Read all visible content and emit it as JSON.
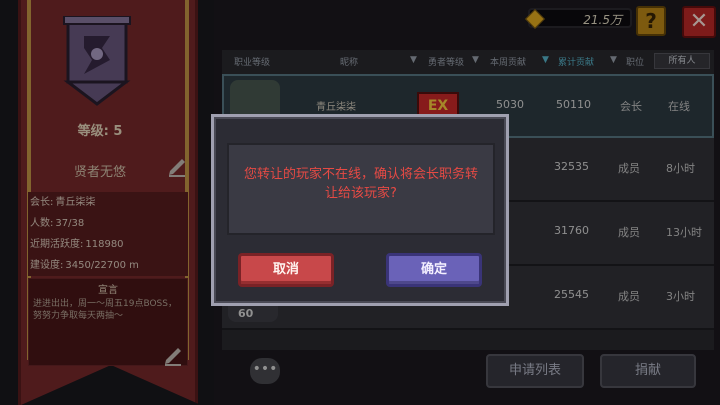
{
  "topbar": {
    "currency": "21.5万",
    "help_label": "?",
    "close_label": "✕"
  },
  "guild": {
    "level": "等级: 5",
    "name": "贤者无悠",
    "info": [
      {
        "label": "会长:",
        "value": "青丘柒柒"
      },
      {
        "label": "人数:",
        "value": "37/38"
      },
      {
        "label": "近期活跃度:",
        "value": "118980"
      },
      {
        "label": "建设度:",
        "value": "3450/22700 m"
      }
    ],
    "announcement_title": "宣言",
    "announcement_text": "进进出出，周一～周五19点BOSS，努努力争取每天两抽～"
  },
  "table": {
    "headers": {
      "job_level": "职业等级",
      "nickname": "昵称",
      "hero_level": "勇者等级",
      "weekly": "本周贡献",
      "total": "累计贡献",
      "role": "职位",
      "filter": "所有人"
    },
    "rows": [
      {
        "name": "青丘柒柒",
        "weekly": "5030",
        "total": "50110",
        "role": "会长",
        "status": "在线",
        "level": ""
      },
      {
        "name": "",
        "weekly": "50",
        "total": "32535",
        "role": "成员",
        "status": "8小时",
        "level": ""
      },
      {
        "name": "",
        "weekly": "00",
        "total": "31760",
        "role": "成员",
        "status": "13小时",
        "level": ""
      },
      {
        "name": "",
        "weekly": "70",
        "total": "25545",
        "role": "成员",
        "status": "3小时",
        "level": "60"
      }
    ]
  },
  "footer": {
    "apply_label": "申请列表",
    "donate_label": "捐献"
  },
  "dialog": {
    "message": "您转让的玩家不在线，确认将会长职务转让给该玩家?",
    "cancel_label": "取消",
    "confirm_label": "确定"
  },
  "colors": {
    "banner": "#7a2a2c",
    "dialog_text": "#e64a44",
    "cancel": "#c8484a",
    "confirm": "#6a62b8"
  }
}
